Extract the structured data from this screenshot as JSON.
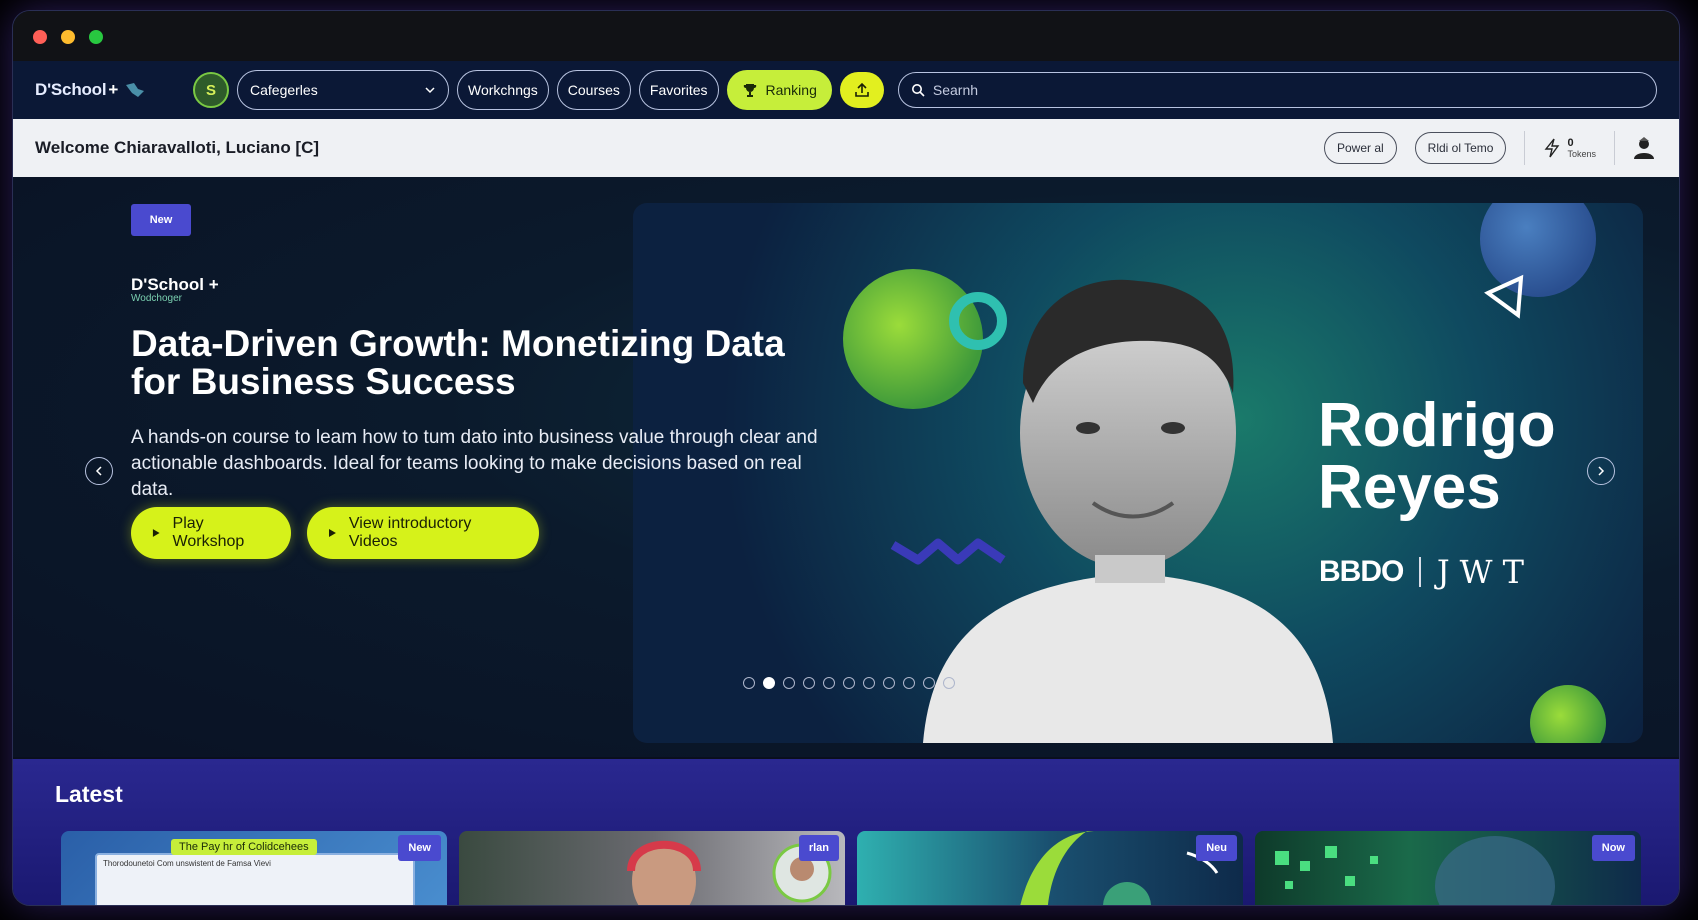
{
  "window": {
    "title_buttons": [
      "close",
      "minimize",
      "maximize"
    ]
  },
  "navbar": {
    "brand": "D'School",
    "brand_plus": "+",
    "user_initial": "S",
    "categories_label": "Cafegerles",
    "workshops_label": "Workchngs",
    "courses_label": "Courses",
    "favorites_label": "Favorites",
    "ranking_label": "Ranking",
    "search_placeholder": "Searnh"
  },
  "welcome_bar": {
    "welcome_text": "Welcome Chiaravalloti, Luciano [C]",
    "power_label": "Power al",
    "theme_label": "Rldi ol Temo",
    "tokens_count": "0",
    "tokens_label": "Tokens"
  },
  "hero": {
    "badge": "New",
    "brand_name": "D'School +",
    "brand_sub": "Wodchoger",
    "title": "Data-Driven Growth: Monetizing Data for Business Success",
    "description": "A hands-on course to leam how to tum dato into business value through clear and actionable dashboards. Ideal for teams looking to make decisions based on real data.",
    "play_label": "Play Workshop",
    "videos_label": "View introductory Videos",
    "speaker_first": "Rodrigo",
    "speaker_last": "Reyes",
    "logo_left": "BBDO",
    "logo_right": "JWT",
    "slide_count": 11,
    "active_slide": 2
  },
  "latest": {
    "title": "Latest",
    "cards": [
      {
        "tag": "New",
        "caption": "The Pay hr of Colidcehees",
        "subcaption": "Thorodounetoi Com unswistent de Famsa Vievi"
      },
      {
        "tag": "rlan"
      },
      {
        "tag": "Neu"
      },
      {
        "tag": "Now"
      }
    ]
  },
  "colors": {
    "accent_lime": "#d6f21a",
    "nav_bg": "#0b1836",
    "badge_blue": "#4a4acf",
    "latest_bg": "#2a2890"
  }
}
